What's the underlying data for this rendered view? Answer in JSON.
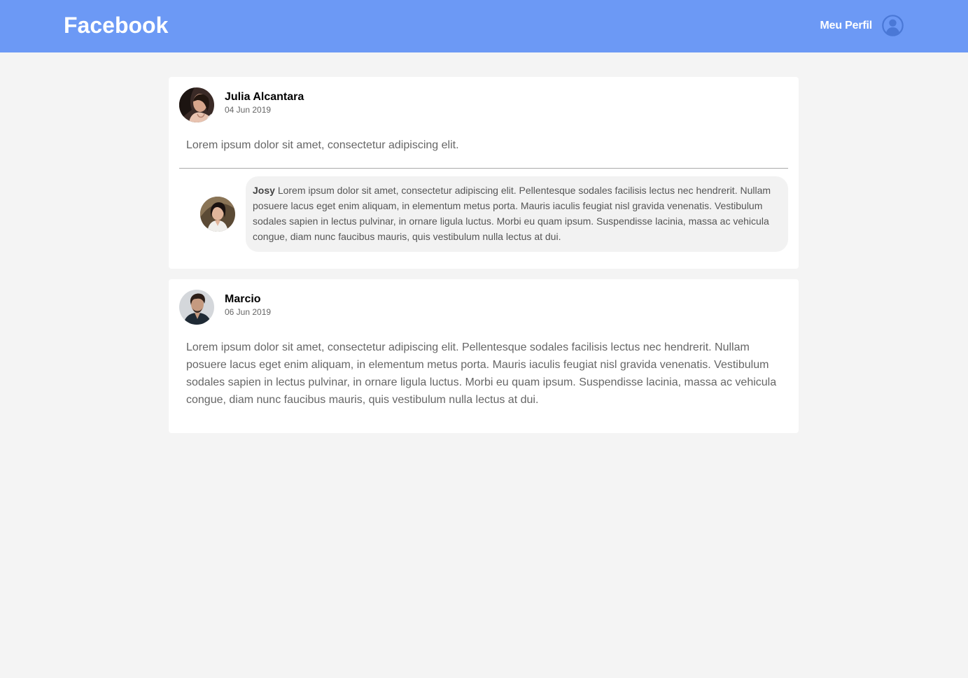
{
  "header": {
    "logo": "Facebook",
    "profile_label": "Meu Perfil",
    "background": "#6c99f5"
  },
  "posts": [
    {
      "author": "Julia Alcantara",
      "date": "04 Jun 2019",
      "body": "Lorem ipsum dolor sit amet, consectetur adipiscing elit.",
      "comments": [
        {
          "author": "Josy",
          "text": "Lorem ipsum dolor sit amet, consectetur adipiscing elit. Pellentesque sodales facilisis lectus nec hendrerit. Nullam posuere lacus eget enim aliquam, in elementum metus porta. Mauris iaculis feugiat nisl gravida venenatis. Vestibulum sodales sapien in lectus pulvinar, in ornare ligula luctus. Morbi eu quam ipsum. Suspendisse lacinia, massa ac vehicula congue, diam nunc faucibus mauris, quis vestibulum nulla lectus at dui."
        }
      ]
    },
    {
      "author": "Marcio",
      "date": "06 Jun 2019",
      "body": "Lorem ipsum dolor sit amet, consectetur adipiscing elit. Pellentesque sodales facilisis lectus nec hendrerit. Nullam posuere lacus eget enim aliquam, in elementum metus porta. Mauris iaculis feugiat nisl gravida venenatis. Vestibulum sodales sapien in lectus pulvinar, in ornare ligula luctus. Morbi eu quam ipsum. Suspendisse lacinia, massa ac vehicula congue, diam nunc faucibus mauris, quis vestibulum nulla lectus at dui.",
      "comments": []
    }
  ]
}
